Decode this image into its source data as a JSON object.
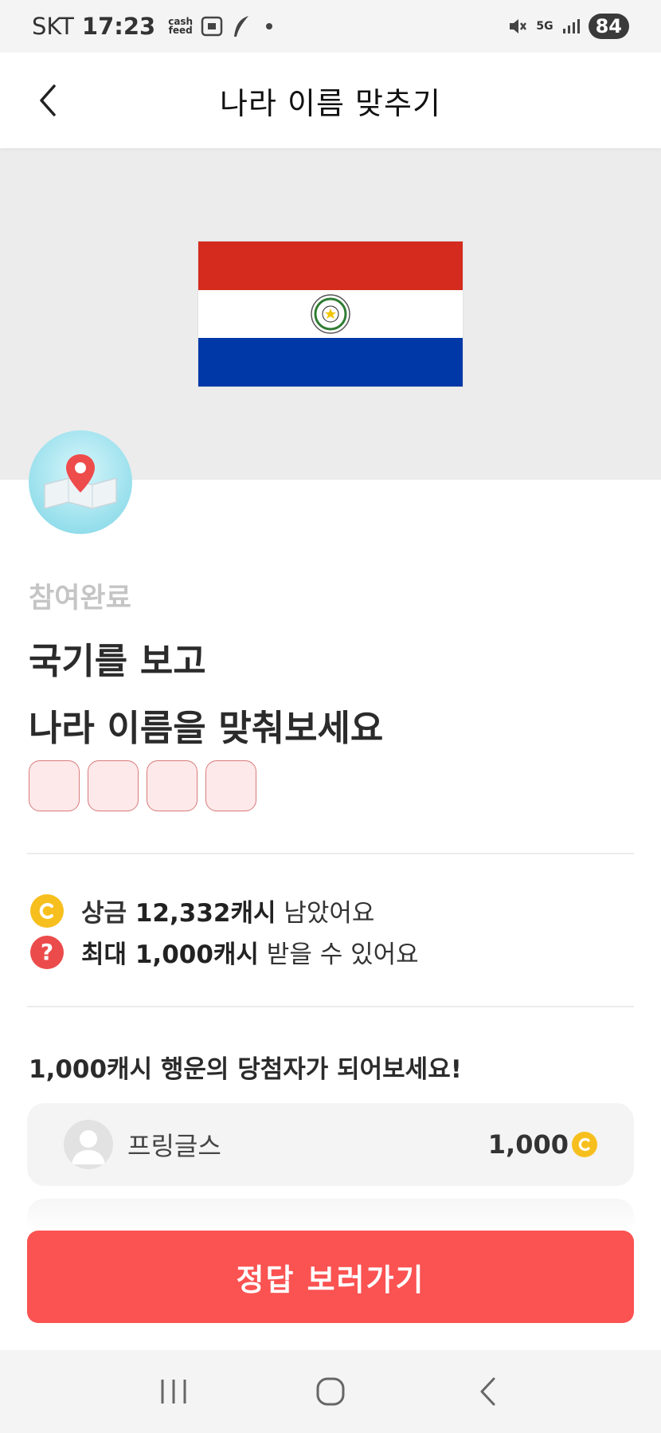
{
  "status_bar": {
    "carrier": "SKT",
    "time": "17:23",
    "cashfeed_text": "cash feed",
    "network": "5G",
    "battery": "84"
  },
  "header": {
    "title": "나라 이름 맞추기"
  },
  "flag": {
    "colors": {
      "top": "#d52b1e",
      "middle": "#ffffff",
      "bottom": "#0038a8"
    }
  },
  "quiz": {
    "status": "참여완료",
    "question_line1": "국기를 보고",
    "question_line2": "나라 이름을 맞춰보세요",
    "answer_box_count": 4
  },
  "info": {
    "prize_prefix": "상금 ",
    "prize_amount": "12,332캐시",
    "prize_suffix": " 남았어요",
    "max_prefix": "최대 ",
    "max_amount": "1,000캐시",
    "max_suffix": " 받을 수 있어요",
    "coin_letter": "C",
    "help_symbol": "?"
  },
  "lucky": {
    "title": "1,000캐시 행운의 당첨자가 되어보세요!",
    "winners": [
      {
        "name": "프링글스",
        "amount": "1,000"
      }
    ]
  },
  "cta": {
    "label": "정답 보러가기"
  },
  "colors": {
    "accent": "#fb5252",
    "coin": "#f7bf1e",
    "help": "#ec4b4b"
  }
}
